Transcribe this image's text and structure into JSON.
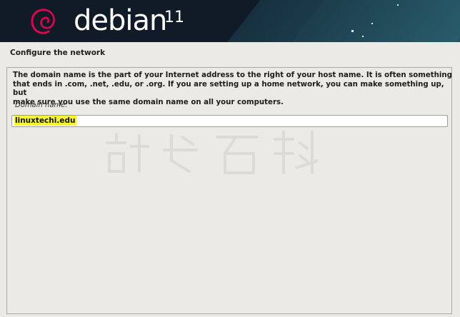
{
  "banner": {
    "brand": "debian",
    "version": "11",
    "logo_icon": "debian-swirl-icon"
  },
  "page": {
    "title": "Configure the network"
  },
  "content": {
    "description_line1": "The domain name is the part of your Internet address to the right of your host name.  It is often something",
    "description_line2": "that ends in .com, .net, .edu, or .org.  If you are setting up a home network, you can make something up, but",
    "description_line3": "make sure you use the same domain name on all your computers.",
    "field_label": "Domain name:",
    "field_value": "linuxtechi.edu"
  },
  "colors": {
    "banner_bg": "#111a27",
    "banner_accent": "#245665",
    "logo_accent": "#d70751",
    "highlight": "#fbf632",
    "page_bg": "#ebeae5"
  }
}
